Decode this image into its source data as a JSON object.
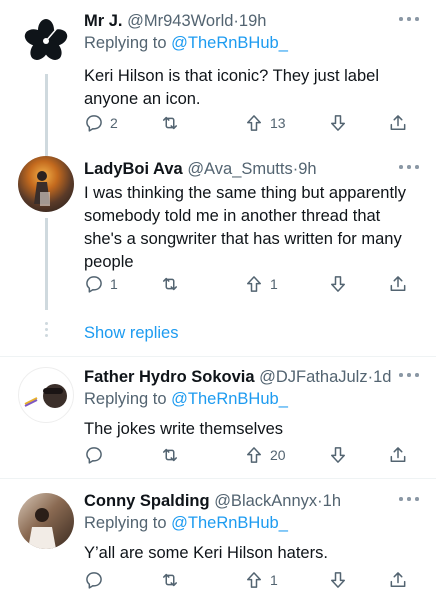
{
  "tweets": [
    {
      "display_name": "Mr J.",
      "handle": "@Mr943World",
      "separator": "·",
      "time": "19h",
      "reply_prefix": "Replying to",
      "reply_to": "@TheRnBHub_",
      "text": "Keri Hilson is that iconic? They just label anyone an icon.",
      "replies": "2",
      "retweets": "",
      "upvotes": "13",
      "avatar_icon": "hibiscus-flower-icon"
    },
    {
      "display_name": "LadyBoi Ava",
      "handle": "@Ava_Smutts",
      "separator": "·",
      "time": "9h",
      "text": "I was thinking the same thing but apparently somebody told me in another thread that she's a songwriter that has written for many people",
      "replies": "1",
      "retweets": "",
      "upvotes": "1",
      "avatar_icon": "photo-avatar"
    },
    {
      "display_name": "Father Hydro Sokovia",
      "handle": "@DJFathaJulz",
      "separator": "·",
      "time": "1d",
      "reply_prefix": "Replying to",
      "reply_to": "@TheRnBHub_",
      "text": "The jokes write themselves",
      "replies": "",
      "retweets": "",
      "upvotes": "20",
      "avatar_icon": "photo-avatar"
    },
    {
      "display_name": "Conny Spalding",
      "handle": "@BlackAnnyx",
      "separator": "·",
      "time": "1h",
      "reply_prefix": "Replying to",
      "reply_to": "@TheRnBHub_",
      "text": "Y’all are some Keri Hilson haters.",
      "replies": "",
      "retweets": "",
      "upvotes": "1",
      "avatar_icon": "photo-avatar"
    }
  ],
  "show_replies": "Show replies",
  "colors": {
    "text": "#0f1419",
    "muted": "#536471",
    "link": "#1d9bf0",
    "divider": "#eff3f4",
    "thread_line": "#cfd9de"
  }
}
